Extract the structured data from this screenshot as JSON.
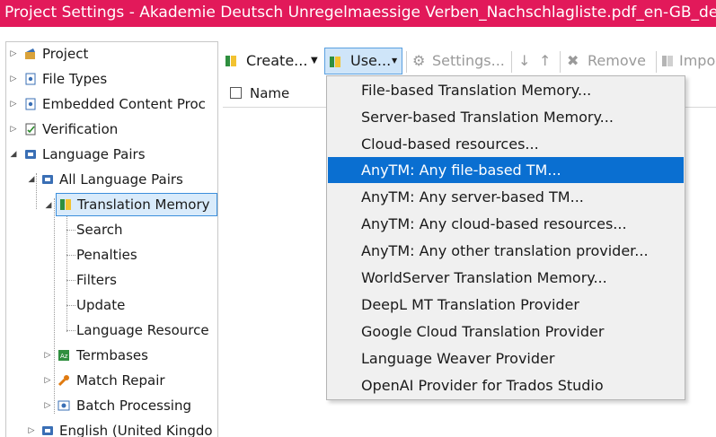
{
  "window": {
    "title": "Project Settings - Akademie Deutsch Unregelmaessige Verben_Nachschlagliste.pdf_en-GB_de-DE",
    "title_bar_color": "#e2195a"
  },
  "tree": {
    "items": [
      {
        "label": "Project",
        "icon": "project-icon"
      },
      {
        "label": "File Types",
        "icon": "file-types-icon"
      },
      {
        "label": "Embedded Content Proc",
        "icon": "embedded-content-icon"
      },
      {
        "label": "Verification",
        "icon": "verification-icon"
      },
      {
        "label": "Language Pairs",
        "icon": "language-pairs-icon"
      },
      {
        "label": "All Language Pairs",
        "icon": "language-pairs-icon"
      },
      {
        "label": "Translation Memory",
        "icon": "translation-memory-icon"
      },
      {
        "label": "Search"
      },
      {
        "label": "Penalties"
      },
      {
        "label": "Filters"
      },
      {
        "label": "Update"
      },
      {
        "label": "Language Resource"
      },
      {
        "label": "Termbases",
        "icon": "termbase-icon"
      },
      {
        "label": "Match Repair",
        "icon": "wrench-icon"
      },
      {
        "label": "Batch Processing",
        "icon": "batch-processing-icon"
      },
      {
        "label": "English (United Kingdo",
        "icon": "language-pairs-icon"
      }
    ]
  },
  "toolbar": {
    "create_label": "Create...",
    "use_label": "Use...",
    "settings_label": "Settings...",
    "remove_label": "Remove",
    "import_label": "Impo"
  },
  "grid": {
    "columns": [
      "Name"
    ]
  },
  "menu": {
    "highlight_color": "#0a6fd1",
    "items": [
      {
        "label": "File-based Translation Memory..."
      },
      {
        "label": "Server-based Translation Memory..."
      },
      {
        "label": "Cloud-based resources..."
      },
      {
        "label": "AnyTM: Any file-based TM..."
      },
      {
        "label": "AnyTM: Any server-based TM..."
      },
      {
        "label": "AnyTM: Any cloud-based resources..."
      },
      {
        "label": "AnyTM: Any other translation provider..."
      },
      {
        "label": "WorldServer Translation Memory..."
      },
      {
        "label": "DeepL MT Translation Provider"
      },
      {
        "label": "Google Cloud Translation Provider"
      },
      {
        "label": "Language Weaver Provider"
      },
      {
        "label": "OpenAI Provider for Trados Studio"
      }
    ]
  }
}
